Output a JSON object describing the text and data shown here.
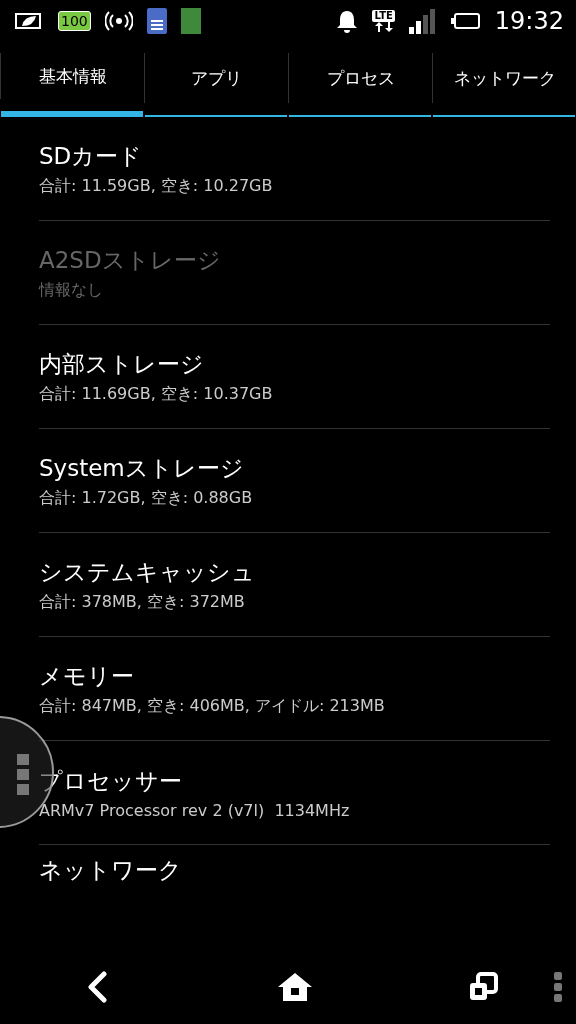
{
  "status_bar": {
    "battery_badge": "100",
    "network_badge": "LTE",
    "time": "19:32"
  },
  "tabs": [
    {
      "label": "基本情報",
      "selected": true
    },
    {
      "label": "アプリ",
      "selected": false
    },
    {
      "label": "プロセス",
      "selected": false
    },
    {
      "label": "ネットワーク",
      "selected": false
    }
  ],
  "items": [
    {
      "title": "SDカード",
      "detail": "合計: 11.59GB, 空き: 10.27GB",
      "disabled": false
    },
    {
      "title": "A2SDストレージ",
      "detail": "情報なし",
      "disabled": true
    },
    {
      "title": "内部ストレージ",
      "detail": "合計: 11.69GB, 空き: 10.37GB",
      "disabled": false
    },
    {
      "title": "Systemストレージ",
      "detail": "合計: 1.72GB, 空き: 0.88GB",
      "disabled": false
    },
    {
      "title": "システムキャッシュ",
      "detail": "合計: 378MB, 空き: 372MB",
      "disabled": false
    },
    {
      "title": "メモリー",
      "detail": "合計: 847MB, 空き: 406MB, アイドル: 213MB",
      "disabled": false
    },
    {
      "title": "プロセッサー",
      "detail": "ARMv7 Processor rev 2 (v7l)  1134MHz",
      "disabled": false
    },
    {
      "title": "ネットワーク",
      "disabled": false
    }
  ]
}
